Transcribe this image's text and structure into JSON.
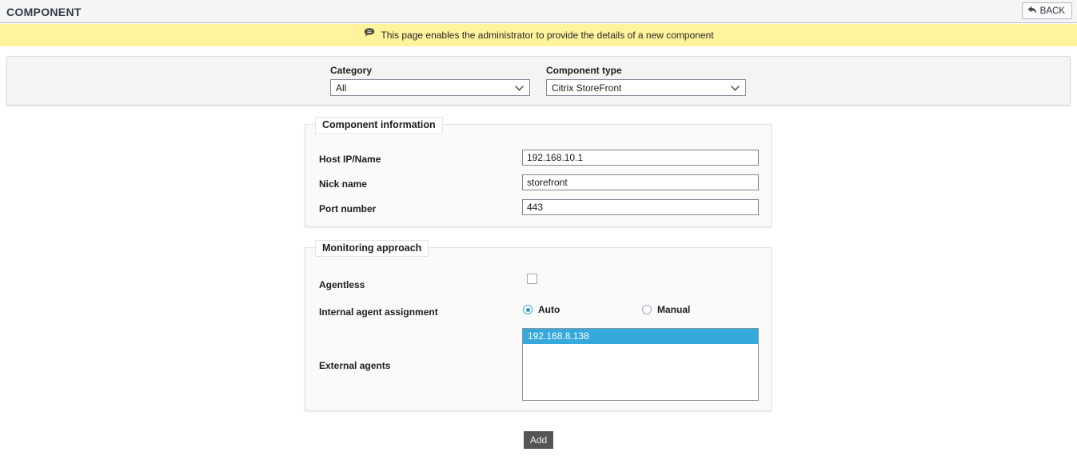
{
  "header": {
    "title": "COMPONENT",
    "back_label": "BACK",
    "back_icon": "back-arrow-icon"
  },
  "info_bar": {
    "icon": "speech-bubble-icon",
    "message": "This page enables the administrator to provide the details of a new component",
    "background_color": "#fff49c"
  },
  "filters": {
    "category": {
      "label": "Category",
      "value": "All"
    },
    "component_type": {
      "label": "Component type",
      "value": "Citrix StoreFront"
    }
  },
  "component_information": {
    "legend": "Component information",
    "fields": [
      {
        "label": "Host IP/Name",
        "value": "192.168.10.1"
      },
      {
        "label": "Nick name",
        "value": "storefront"
      },
      {
        "label": "Port number",
        "value": "443"
      }
    ]
  },
  "monitoring_approach": {
    "legend": "Monitoring approach",
    "agentless": {
      "label": "Agentless",
      "checked": false
    },
    "internal_agent_assignment": {
      "label": "Internal agent assignment",
      "options": [
        {
          "label": "Auto",
          "selected": true
        },
        {
          "label": "Manual",
          "selected": false
        }
      ]
    },
    "external_agents": {
      "label": "External agents",
      "items": [
        {
          "value": "192.168.8.138",
          "selected": true
        }
      ],
      "selection_color": "#35a8dc"
    }
  },
  "footer": {
    "add_label": "Add"
  }
}
